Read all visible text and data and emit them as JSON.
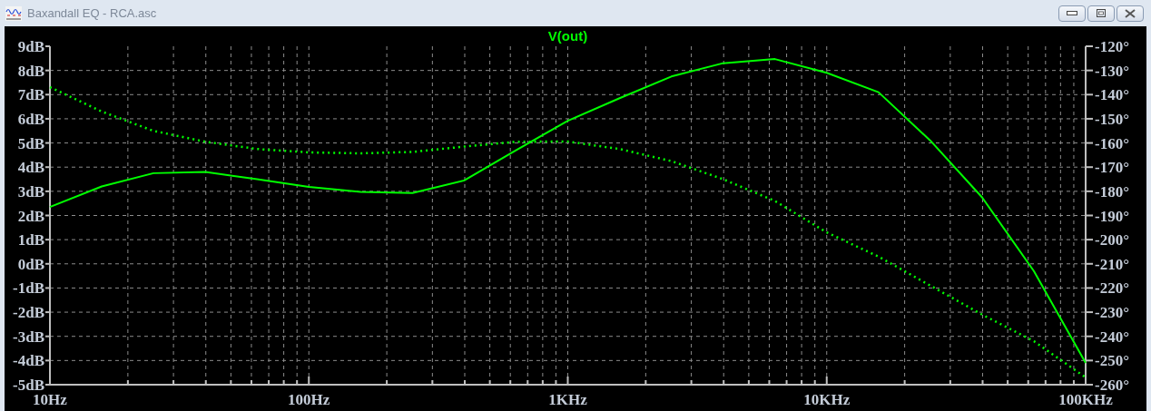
{
  "window": {
    "title": "Baxandall EQ - RCA.asc",
    "controls": [
      {
        "kind": "minimize"
      },
      {
        "kind": "restore"
      },
      {
        "kind": "close"
      }
    ]
  },
  "plot": {
    "chart_data": {
      "type": "line",
      "title": "V(out)",
      "categories": [
        "10Hz",
        null,
        null,
        null,
        null,
        "100Hz",
        null,
        null,
        null,
        null,
        "1KHz",
        null,
        null,
        null,
        null,
        "10KHz",
        null,
        null,
        null,
        null,
        "100KHz"
      ],
      "grid": true,
      "ylim": [
        -5,
        9
      ],
      "yticks": [
        {
          "value": 9,
          "label": "9dB"
        },
        {
          "value": 8,
          "label": "8dB"
        },
        {
          "value": 7,
          "label": "7dB"
        },
        {
          "value": 6,
          "label": "6dB"
        },
        {
          "value": 5,
          "label": "5dB"
        },
        {
          "value": 4,
          "label": "4dB"
        },
        {
          "value": 3,
          "label": "3dB"
        },
        {
          "value": 2,
          "label": "2dB"
        },
        {
          "value": 1,
          "label": "1dB"
        },
        {
          "value": 0,
          "label": "0dB"
        },
        {
          "value": -1,
          "label": "-1dB"
        },
        {
          "value": -2,
          "label": "-2dB"
        },
        {
          "value": -3,
          "label": "-3dB"
        },
        {
          "value": -4,
          "label": "-4dB"
        },
        {
          "value": -5,
          "label": "-5dB"
        }
      ],
      "y2lim": [
        -260,
        -120
      ],
      "y2ticks": [
        {
          "value": -120,
          "label": "-120°"
        },
        {
          "value": -130,
          "label": "-130°"
        },
        {
          "value": -140,
          "label": "-140°"
        },
        {
          "value": -150,
          "label": "-150°"
        },
        {
          "value": -160,
          "label": "-160°"
        },
        {
          "value": -170,
          "label": "-170°"
        },
        {
          "value": -180,
          "label": "-180°"
        },
        {
          "value": -190,
          "label": "-190°"
        },
        {
          "value": -200,
          "label": "-200°"
        },
        {
          "value": -210,
          "label": "-210°"
        },
        {
          "value": -220,
          "label": "-220°"
        },
        {
          "value": -230,
          "label": "-230°"
        },
        {
          "value": -240,
          "label": "-240°"
        },
        {
          "value": -250,
          "label": "-250°"
        },
        {
          "value": -260,
          "label": "-260°"
        }
      ],
      "series": [
        {
          "color": "#00ff00",
          "values": [
            2.35,
            3.2,
            3.75,
            3.8,
            3.5,
            3.18,
            2.98,
            2.93,
            3.45,
            4.7,
            5.92,
            6.85,
            7.75,
            8.3,
            8.47,
            7.9,
            7.1,
            5.1,
            2.75,
            -0.3,
            -4.1
          ]
        },
        {
          "color": "#00ff00",
          "axis": "y2",
          "line_style": "dotted",
          "values": [
            -136.9,
            -147,
            -155,
            -159.5,
            -162.5,
            -163.9,
            -164.3,
            -163.7,
            -161.5,
            -159.5,
            -159.4,
            -162.5,
            -167.5,
            -175,
            -184,
            -197,
            -207,
            -219,
            -231,
            -242,
            -257
          ]
        }
      ]
    }
  }
}
